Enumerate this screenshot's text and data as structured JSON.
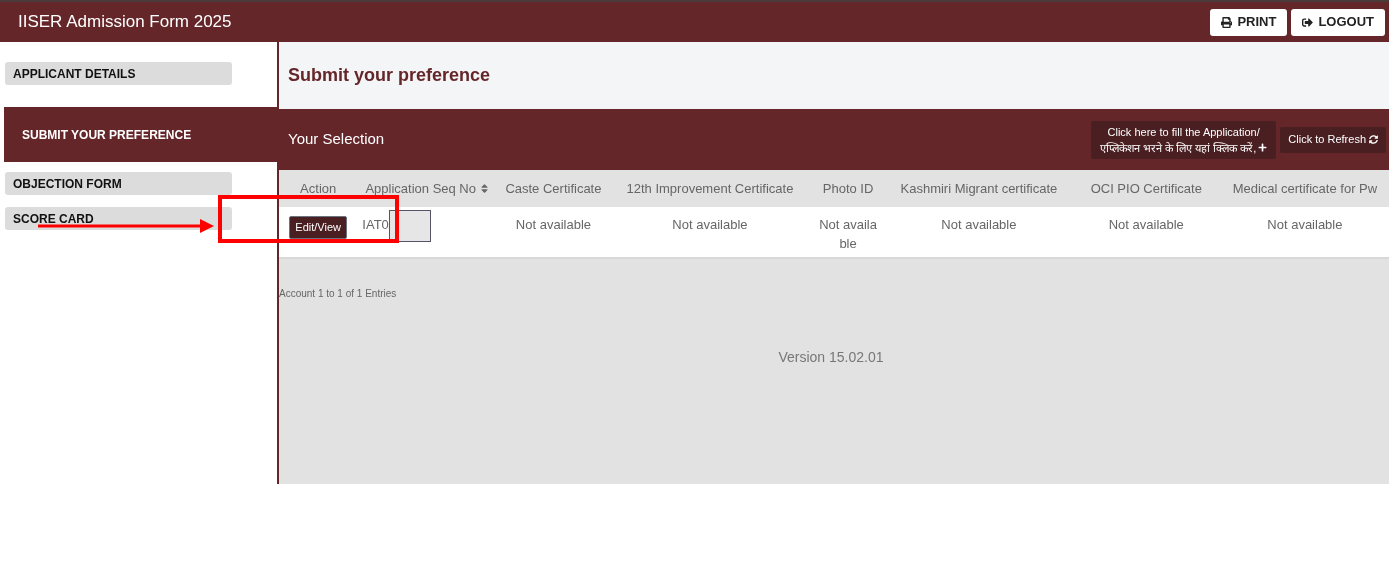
{
  "header": {
    "title": "IISER Admission Form 2025",
    "buttons": [
      {
        "kind": "print",
        "label": "PRINT"
      },
      {
        "kind": "logout",
        "label": "LOGOUT"
      }
    ]
  },
  "sidebar": {
    "items": [
      {
        "label": "APPLICANT DETAILS",
        "selected": false
      },
      {
        "label": "SUBMIT YOUR PREFERENCE",
        "selected": true
      },
      {
        "label": "OBJECTION FORM",
        "selected": false
      },
      {
        "label": "SCORE CARD",
        "selected": false
      }
    ]
  },
  "page_title": "Submit your preference",
  "panel": {
    "title": "Your Selection",
    "fill_button": [
      "Click here to fill the Application/",
      "एप्लिकेशन भरने के लिए यहां क्लिक करें,"
    ],
    "refresh_button": "Click to Refresh"
  },
  "table": {
    "columns": [
      {
        "label": "Action",
        "sortable": false
      },
      {
        "label": "Application Seq No",
        "sortable": true
      },
      {
        "label": "Caste Certificate",
        "sortable": false
      },
      {
        "label": "12th Improvement Certificate",
        "sortable": false
      },
      {
        "label": "Photo ID",
        "sortable": false
      },
      {
        "label": "Kashmiri Migrant certificate",
        "sortable": false
      },
      {
        "label": "OCI PIO Certificate",
        "sortable": false
      },
      {
        "label": "Medical certificate for Pw",
        "sortable": false
      }
    ],
    "rows": [
      {
        "cells": [
          "Edit/View",
          "IAT0",
          "Not available",
          "Not available",
          "Not available",
          "Not available",
          "Not available",
          "Not available"
        ]
      }
    ]
  },
  "entries": "Account 1  to 1  of 1 Entries",
  "version": "Version 15.02.01"
}
